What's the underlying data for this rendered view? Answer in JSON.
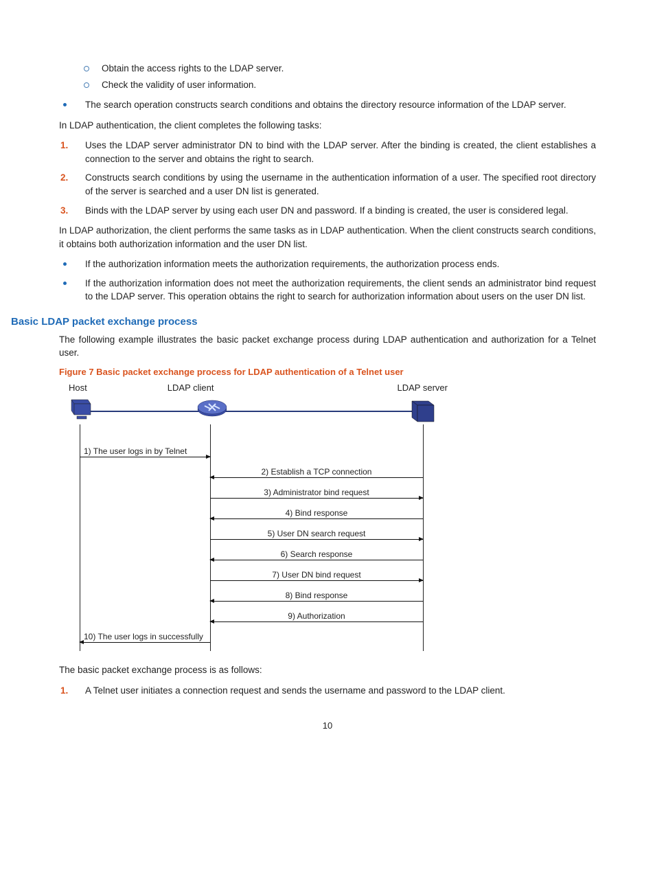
{
  "sub_bullets": [
    "Obtain the access rights to the LDAP server.",
    "Check the validity of user information."
  ],
  "dot_search": "The search operation constructs search conditions and obtains the directory resource information of the LDAP server.",
  "para_auth_intro": "In LDAP authentication, the client completes the following tasks:",
  "auth_steps": [
    "Uses the LDAP server administrator DN to bind with the LDAP server. After the binding is created, the client establishes a connection to the server and obtains the right to search.",
    "Constructs search conditions by using the username in the authentication information of a user. The specified root directory of the server is searched and a user DN list is generated.",
    "Binds with the LDAP server by using each user DN and password. If a binding is created, the user is considered legal."
  ],
  "para_authz": "In LDAP authorization, the client performs the same tasks as in LDAP authentication. When the client constructs search conditions, it obtains both authorization information and the user DN list.",
  "authz_bullets": [
    "If the authorization information meets the authorization requirements, the authorization process ends.",
    "If the authorization information does not meet the authorization requirements, the client sends an administrator bind request to the LDAP server. This operation obtains the right to search for authorization information about users on the user DN list."
  ],
  "section_heading": "Basic LDAP packet exchange process",
  "section_intro": "The following example illustrates the basic packet exchange process during LDAP authentication and authorization for a Telnet user.",
  "figure_caption": "Figure 7 Basic packet exchange process for LDAP authentication of a Telnet user",
  "diagram": {
    "host": "Host",
    "client": "LDAP client",
    "server": "LDAP server",
    "messages": [
      {
        "seg": "hc",
        "dir": "right",
        "label": "1) The user logs in by Telnet"
      },
      {
        "seg": "cs",
        "dir": "left",
        "label": "2) Establish a TCP connection"
      },
      {
        "seg": "cs",
        "dir": "right",
        "label": "3) Administrator bind request"
      },
      {
        "seg": "cs",
        "dir": "left",
        "label": "4) Bind response"
      },
      {
        "seg": "cs",
        "dir": "right",
        "label": "5) User DN search request"
      },
      {
        "seg": "cs",
        "dir": "left",
        "label": "6) Search response"
      },
      {
        "seg": "cs",
        "dir": "right",
        "label": "7) User DN bind request"
      },
      {
        "seg": "cs",
        "dir": "left",
        "label": "8) Bind response"
      },
      {
        "seg": "cs",
        "dir": "left",
        "label": "9) Authorization"
      },
      {
        "seg": "hc",
        "dir": "left",
        "label": "10) The user logs in successfully"
      }
    ]
  },
  "post_fig_para": "The basic packet exchange process is as follows:",
  "post_fig_steps": [
    "A Telnet user initiates a connection request and sends the username and password to the LDAP client."
  ],
  "page_number": "10"
}
